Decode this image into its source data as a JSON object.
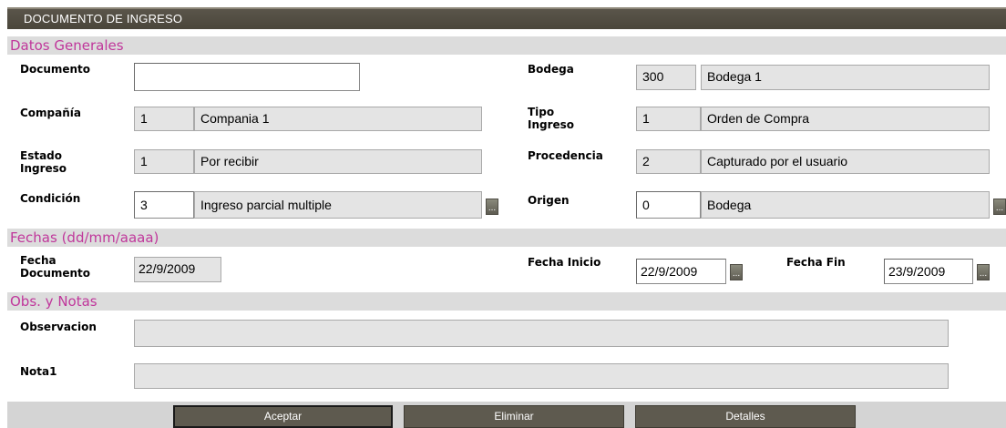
{
  "window": {
    "title": "DOCUMENTO DE INGRESO"
  },
  "sections": {
    "datos_generales": "Datos Generales",
    "fechas": "Fechas (dd/mm/aaaa)",
    "obs_notas": "Obs. y Notas"
  },
  "fields": {
    "documento": {
      "label": "Documento",
      "value": ""
    },
    "bodega": {
      "label": "Bodega",
      "code": "300",
      "name": "Bodega 1"
    },
    "compania": {
      "label": "Compañía",
      "code": "1",
      "name": "Compania 1"
    },
    "tipo_ingreso": {
      "label_line1": "Tipo",
      "label_line2": "Ingreso",
      "code": "1",
      "name": "Orden de Compra"
    },
    "estado_ingreso": {
      "label_line1": "Estado",
      "label_line2": "Ingreso",
      "code": "1",
      "name": "Por recibir"
    },
    "procedencia": {
      "label": "Procedencia",
      "code": "2",
      "name": "Capturado por el usuario"
    },
    "condicion": {
      "label": "Condición",
      "code": "3",
      "name": "Ingreso parcial multiple"
    },
    "origen": {
      "label": "Origen",
      "code": "0",
      "name": "Bodega"
    },
    "fecha_documento": {
      "label_line1": "Fecha",
      "label_line2": "Documento",
      "value": "22/9/2009"
    },
    "fecha_inicio": {
      "label": "Fecha Inicio",
      "value": "22/9/2009"
    },
    "fecha_fin": {
      "label": "Fecha Fin",
      "value": "23/9/2009"
    },
    "observacion": {
      "label": "Observacion",
      "value": ""
    },
    "nota1": {
      "label": "Nota1",
      "value": ""
    }
  },
  "buttons": {
    "aceptar": "Aceptar",
    "eliminar": "Eliminar",
    "detalles": "Detalles",
    "lookup": "..."
  },
  "colors": {
    "title_bar": "#4f4b40",
    "section_header_text": "#c0379b",
    "section_header_bg": "#dcdcdc",
    "button_bg": "#5e5a4f"
  }
}
